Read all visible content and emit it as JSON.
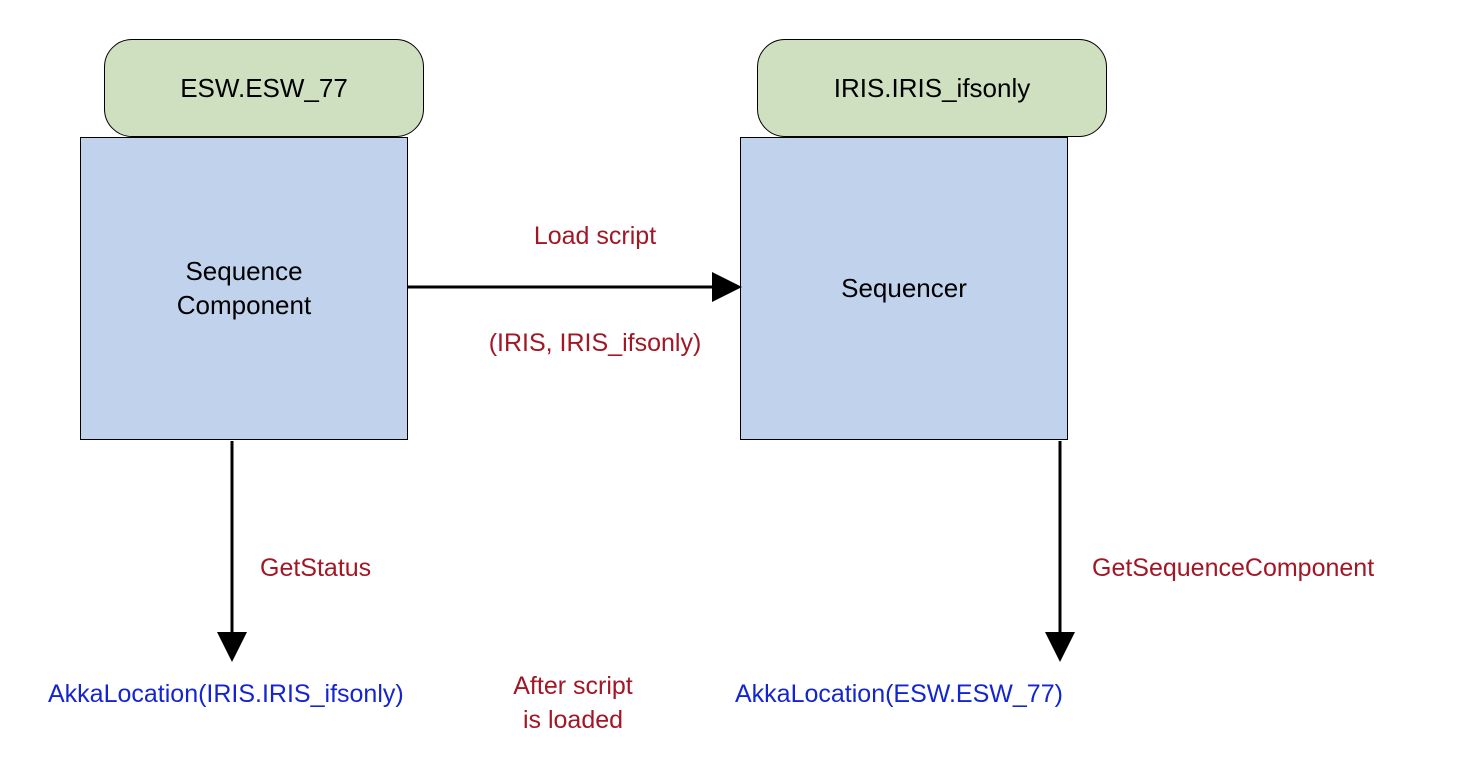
{
  "left": {
    "header": "ESW.ESW_77",
    "box": "Sequence\nComponent",
    "op": "GetStatus",
    "result": "AkkaLocation(IRIS.IRIS_ifsonly)"
  },
  "right": {
    "header": "IRIS.IRIS_ifsonly",
    "box": "Sequencer",
    "op": "GetSequenceComponent",
    "result": "AkkaLocation(ESW.ESW_77)"
  },
  "arrow": {
    "top_label": "Load script",
    "bottom_label": "(IRIS, IRIS_ifsonly)"
  },
  "note": "After  script\nis loaded"
}
